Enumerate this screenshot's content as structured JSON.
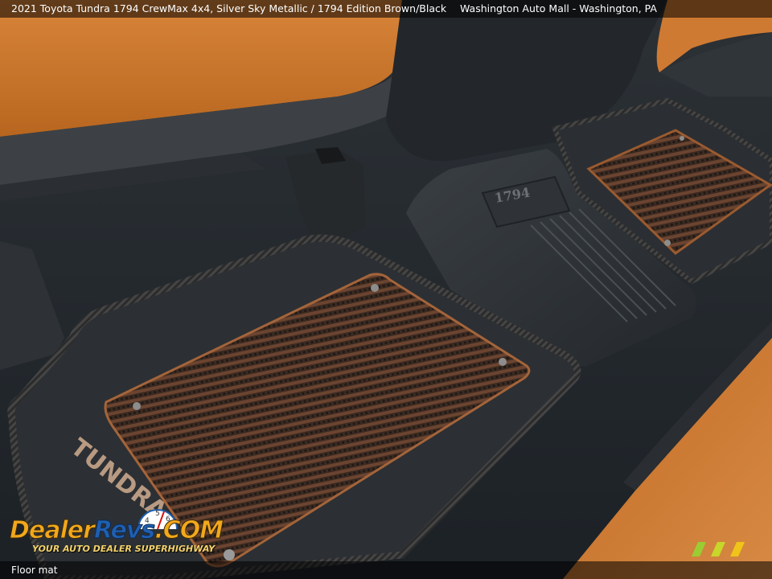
{
  "header": {
    "title": "2021 Toyota Tundra 1794 CrewMax 4x4,  Silver Sky Metallic / 1794 Edition Brown/Black",
    "dealer": "Washington Auto Mall - Washington, PA"
  },
  "footer": {
    "caption": "Floor mat"
  },
  "photo": {
    "mat_text_front": "TUNDRA",
    "badge_text": "1794",
    "colors": {
      "leather": "#c8752e",
      "mat_rubber": "#2a2e31",
      "carpet": "#20252b",
      "mat_pile": "#5a3a26",
      "piping": "#1a1a1a"
    }
  },
  "logo": {
    "brand_part1": "Dealer",
    "brand_part2": "Revs",
    "brand_part3": ".COM",
    "tagline": "YOUR AUTO DEALER SUPERHIGHWAY",
    "gauge_numbers": [
      "4",
      "5",
      "6"
    ]
  },
  "watermark": {
    "icon": "wmm-logo-icon"
  }
}
